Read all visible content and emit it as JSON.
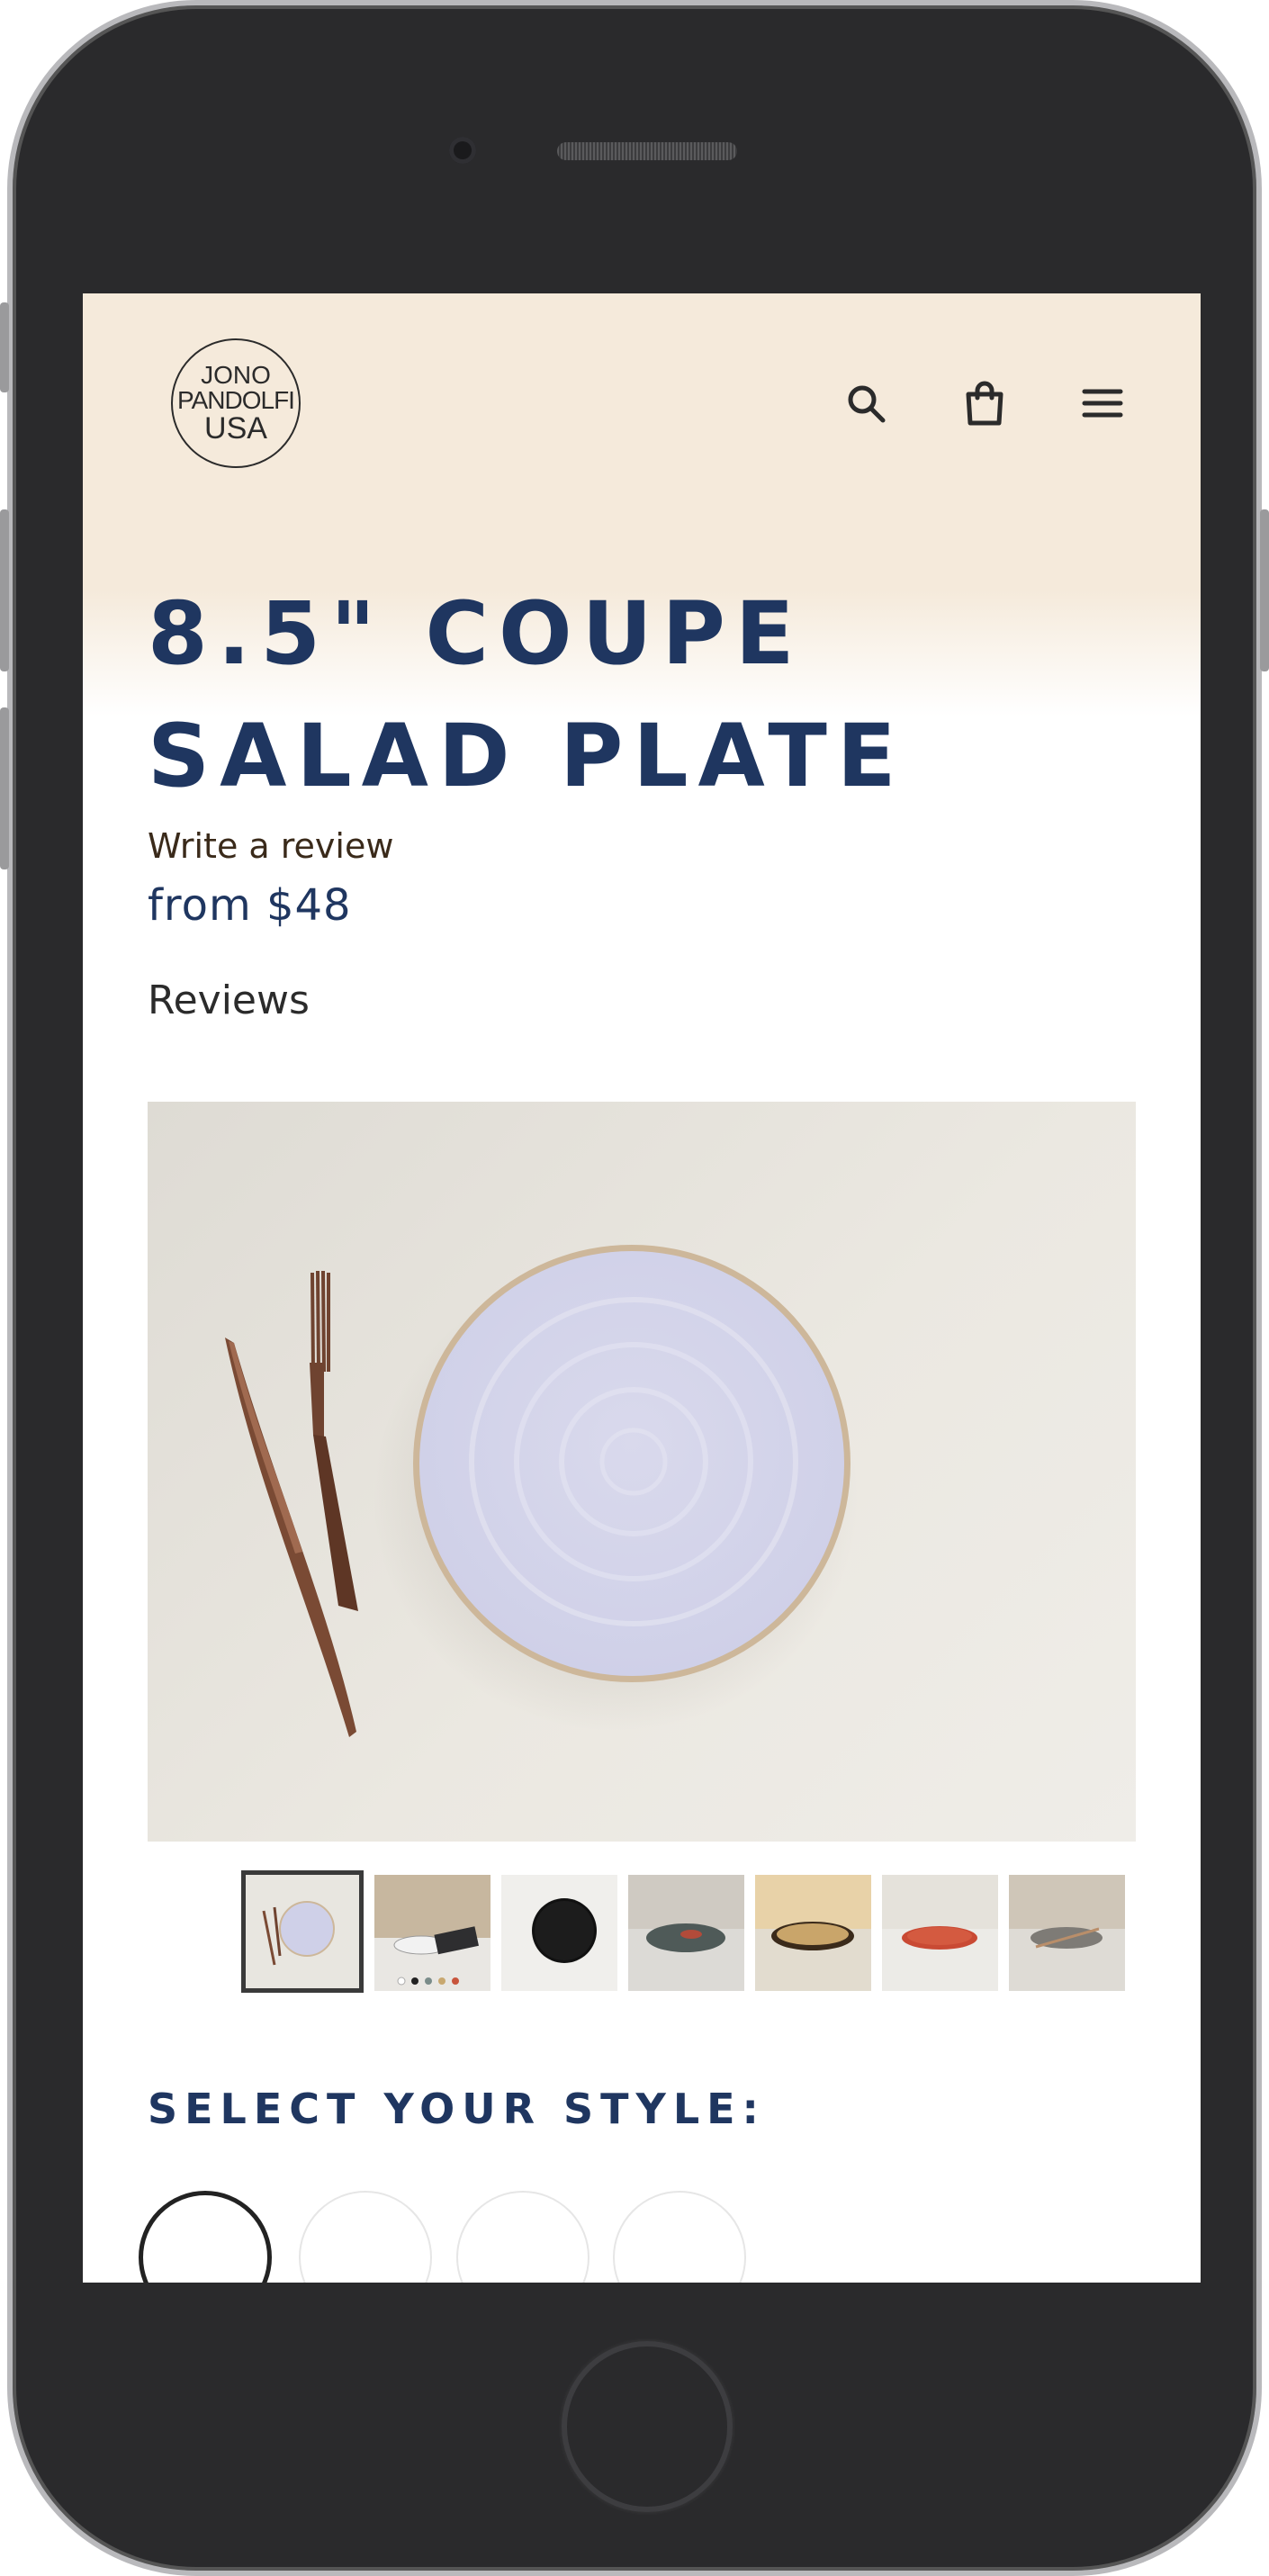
{
  "header": {
    "logo": {
      "line1": "JONO",
      "line2": "PANDOLFI",
      "line3": "USA"
    },
    "icons": [
      "search-icon",
      "bag-icon",
      "menu-icon"
    ]
  },
  "product": {
    "title": "8.5\" Coupe Salad Plate",
    "write_review": "Write a review",
    "price": "from $48",
    "reviews_label": "Reviews"
  },
  "gallery": {
    "thumbnail_count": 7,
    "active_index": 0
  },
  "style_selector": {
    "label": "Select your style:",
    "option_count": 4,
    "selected_index": 0
  },
  "colors": {
    "navy": "#1f3660",
    "header_bg": "#f5eadb",
    "device": "#2a2a2c"
  }
}
